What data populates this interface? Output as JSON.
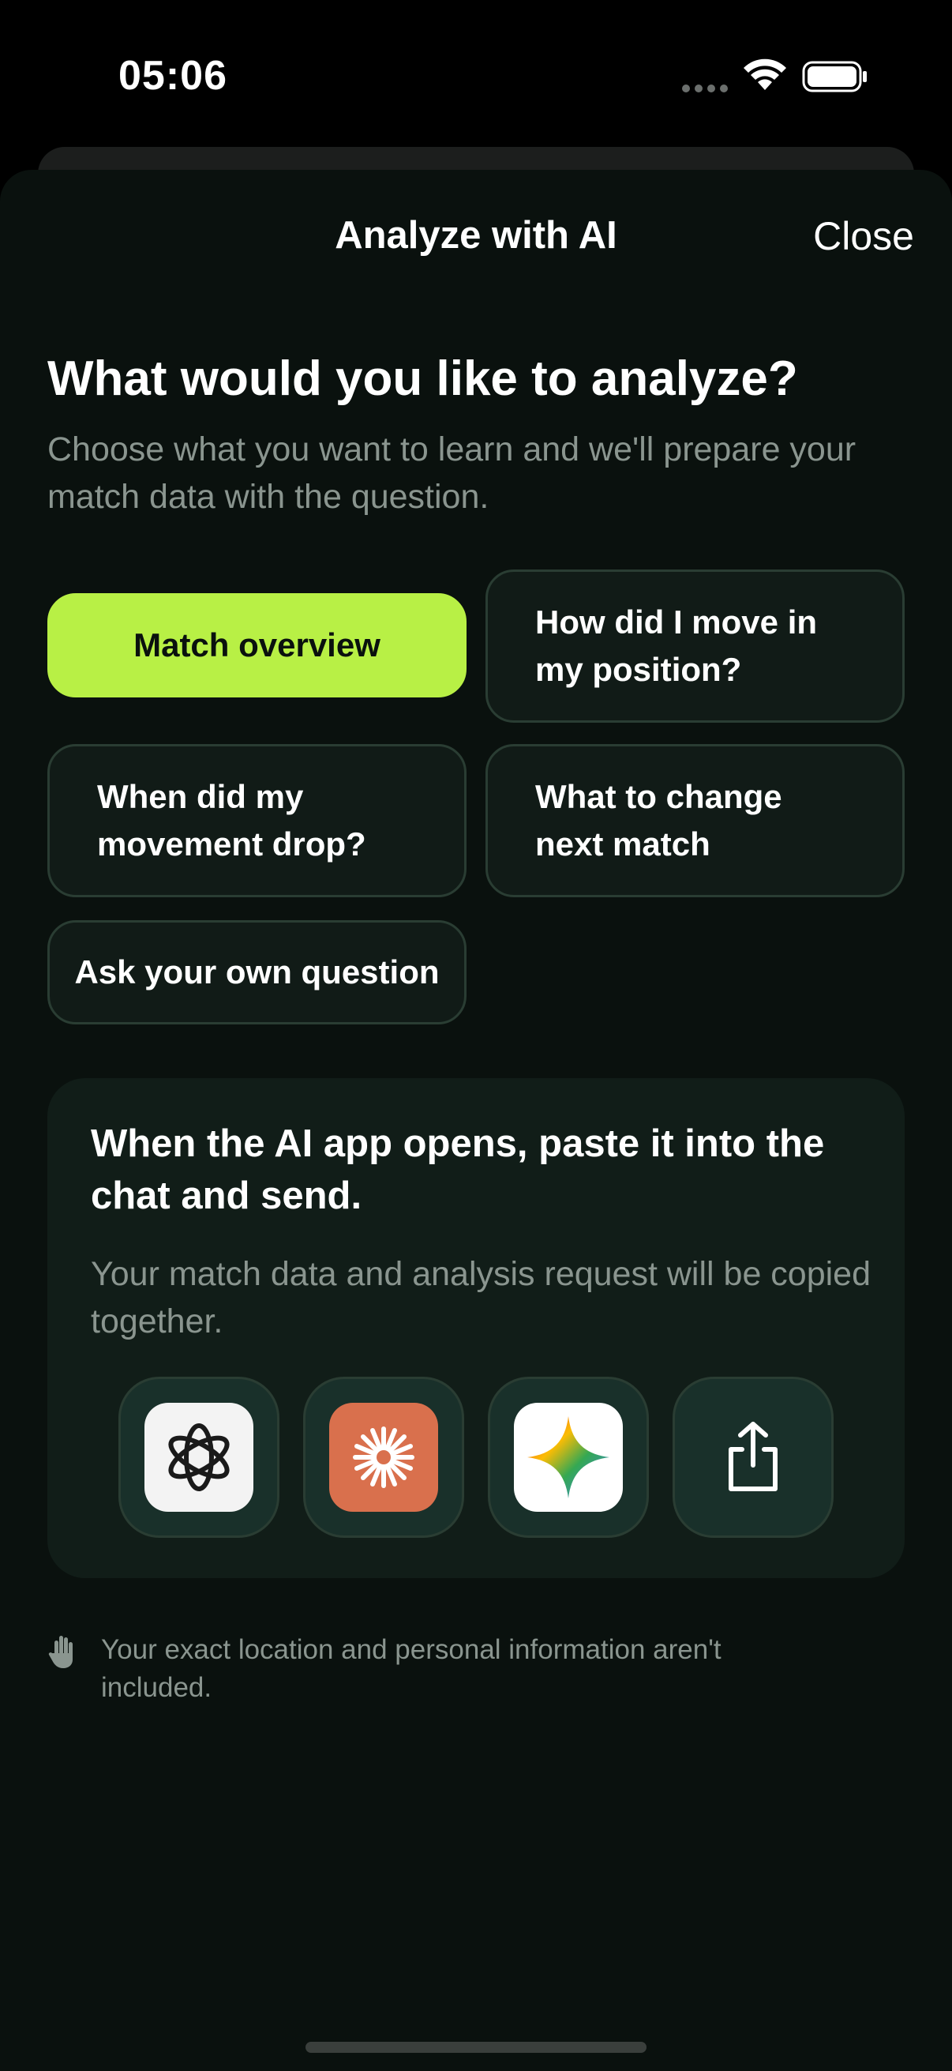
{
  "status_bar": {
    "time": "05:06"
  },
  "header": {
    "title": "Analyze with AI",
    "close_label": "Close"
  },
  "prompt": {
    "heading": "What would you like to analyze?",
    "subheading": "Choose what you want to learn and we'll prepare your match data with the question."
  },
  "options": [
    {
      "label": "Match overview",
      "selected": true
    },
    {
      "label": "How did I move in my position?",
      "selected": false
    },
    {
      "label": "When did my movement drop?",
      "selected": false
    },
    {
      "label": "What to change next match",
      "selected": false
    },
    {
      "label": "Ask your own question",
      "selected": false
    }
  ],
  "info_card": {
    "title": "When the AI app opens, paste it into the chat and send.",
    "body": "Your match data and analysis request will be copied together.",
    "apps": [
      {
        "icon": "chatgpt-icon"
      },
      {
        "icon": "claude-icon"
      },
      {
        "icon": "gemini-icon"
      },
      {
        "icon": "share-icon"
      }
    ]
  },
  "privacy_note": "Your exact location and personal information aren't included.",
  "colors": {
    "accent": "#b8f045",
    "background": "#0a110e",
    "card": "#111d18"
  }
}
